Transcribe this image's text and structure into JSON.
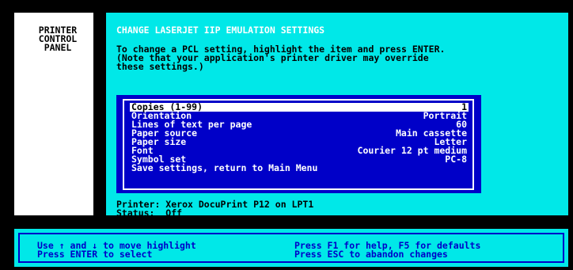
{
  "side_panel": {
    "title_lines": [
      "PRINTER",
      "CONTROL",
      "PANEL"
    ]
  },
  "header": {
    "title": "CHANGE LASERJET IIP EMULATION SETTINGS",
    "instructions": [
      "To change a PCL setting, highlight the item and press ENTER.",
      "(Note that your application's printer driver may override",
      "these settings.)"
    ]
  },
  "menu": {
    "items": [
      {
        "label": "Copies (1-99)",
        "value": "1",
        "selected": true
      },
      {
        "label": "Orientation",
        "value": "Portrait"
      },
      {
        "label": "Lines of text per page",
        "value": "60"
      },
      {
        "label": "Paper source",
        "value": "Main cassette"
      },
      {
        "label": "Paper size",
        "value": "Letter"
      },
      {
        "label": "Font",
        "value": "Courier 12 pt medium"
      },
      {
        "label": "Symbol set",
        "value": "PC-8"
      },
      {
        "label": "Save settings, return to Main Menu",
        "value": ""
      }
    ]
  },
  "status": {
    "printer_line": "Printer: Xerox DocuPrint P12 on LPT1",
    "status_line": "Status:  Off"
  },
  "help": {
    "left": [
      "Use ↑ and ↓ to move highlight",
      "Press ENTER to select"
    ],
    "right": [
      "Press F1 for help, F5 for defaults",
      "Press ESC to abandon changes"
    ]
  },
  "colors": {
    "background": "#000000",
    "panel": "#00e8e8",
    "menu": "#0000c8",
    "highlight": "#ffffff"
  }
}
